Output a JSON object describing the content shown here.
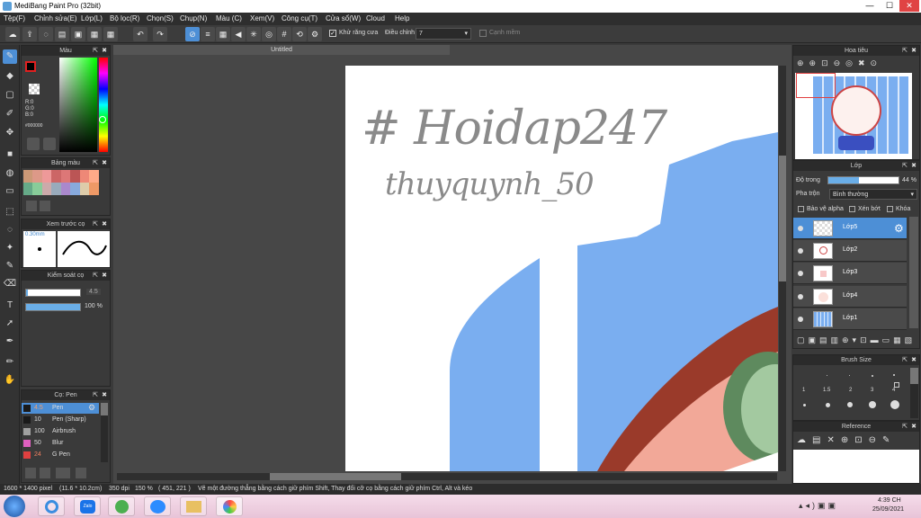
{
  "window": {
    "title": "MediBang Paint Pro (32bit)",
    "minimize": "—",
    "maximize": "☐",
    "close": "✕"
  },
  "menu": [
    "Tệp(F)",
    "Chỉnh sửa(E)",
    "Lớp(L)",
    "Bộ lọc(R)",
    "Chọn(S)",
    "Chụp(N)",
    "Màu (C)",
    "Xem(V)",
    "Công cụ(T)",
    "Cửa sổ(W)",
    "Cloud",
    "Help"
  ],
  "toolbar": {
    "antialias_label": "Khử răng cưa",
    "correction_label": "Điều chỉnh",
    "correction_value": "7",
    "snap_label": "Cạnh mềm"
  },
  "color_panel": {
    "title": "Màu",
    "r": "R:0",
    "g": "G:0",
    "b": "B:0",
    "hex": "#000000"
  },
  "palette_panel": {
    "title": "Bảng màu"
  },
  "brush_preview_panel": {
    "title": "Xem trước cọ",
    "size": "0.30mm"
  },
  "brush_control_panel": {
    "title": "Kiểm soát cọ",
    "size_value": "4.5",
    "opacity_value": "100 %"
  },
  "brush_panel": {
    "title": "Cọ: Pen",
    "items": [
      {
        "value": "4.5",
        "name": "Pen",
        "color": "#1a1a1a"
      },
      {
        "value": "10",
        "name": "Pen (Sharp)",
        "color": "#1a1a1a"
      },
      {
        "value": "100",
        "name": "Airbrush",
        "color": "#a0a0a0"
      },
      {
        "value": "50",
        "name": "Blur",
        "color": "#e060c0"
      },
      {
        "value": "24",
        "name": "G Pen",
        "color": "#e04040"
      }
    ]
  },
  "document": {
    "tab_title": "Untitled",
    "handwriting_line1": "# Hoidap247",
    "handwriting_line2": "thuyquynh_50"
  },
  "navigator_panel": {
    "title": "Hoa tiêu"
  },
  "layer_panel": {
    "title": "Lớp",
    "opacity_label": "Độ trong",
    "opacity_value": "44 %",
    "blend_label": "Pha trộn",
    "blend_value": "Bình thường",
    "protect_alpha": "Bảo vệ alpha",
    "clipping": "Xén bớt",
    "lock": "Khóa",
    "layers": [
      "Lớp5",
      "Lớp2",
      "Lớp3",
      "Lớp4",
      "Lớp1"
    ]
  },
  "brush_size_panel": {
    "title": "Brush Size",
    "sizes": [
      "1",
      "1.5",
      "2",
      "3",
      "4"
    ]
  },
  "reference_panel": {
    "title": "Reference"
  },
  "status": {
    "size": "1600 * 1400 pixel",
    "cm": "(11.6 * 10.2cm)",
    "dpi": "350 dpi",
    "zoom": "150 %",
    "coords": "( 451, 221 )",
    "hint": "Vẽ một đường thẳng bằng cách giữ phím Shift, Thay đổi cỡ cọ bằng cách giữ phím Ctrl, Alt và kéo"
  },
  "taskbar": {
    "time": "4:39 CH",
    "date": "25/09/2021",
    "zalo": "Zalo"
  },
  "colors": {
    "accent": "#4d8fd6",
    "shape_blue": "#7aaef0",
    "brown": "#9a3a2a",
    "green": "#5e8a5e",
    "pink": "#f2a898"
  }
}
